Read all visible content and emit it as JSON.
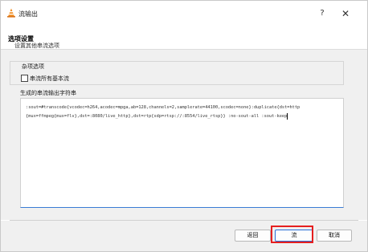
{
  "window": {
    "title": "流输出",
    "help_label": "?",
    "close_label": "✕"
  },
  "header": {
    "title": "选项设置",
    "subtitle": "设置其他串流选项"
  },
  "misc_group": {
    "title": "杂项选项",
    "checkbox_label": "串流所有基本流",
    "checkbox_checked": false
  },
  "output_group": {
    "title": "生成的串流输出字符串",
    "sout_line1": ":sout=#transcode{vcodec=h264,acodec=mpga,ab=128,channels=2,samplerate=44100,scodec=none}:duplicate{dst=http",
    "sout_line2": "{mux=ffmpeg{mux=flv},dst=:8080/live_http},dst=rtp{sdp=rtsp://:8554/live_rtsp}} :no-sout-all :sout-keep"
  },
  "footer": {
    "back_label": "返回",
    "stream_label": "流",
    "cancel_label": "取消"
  },
  "colors": {
    "highlight": "#e51f1f",
    "focus_border": "#2b6fd6",
    "app_icon": "#f08a1c"
  }
}
